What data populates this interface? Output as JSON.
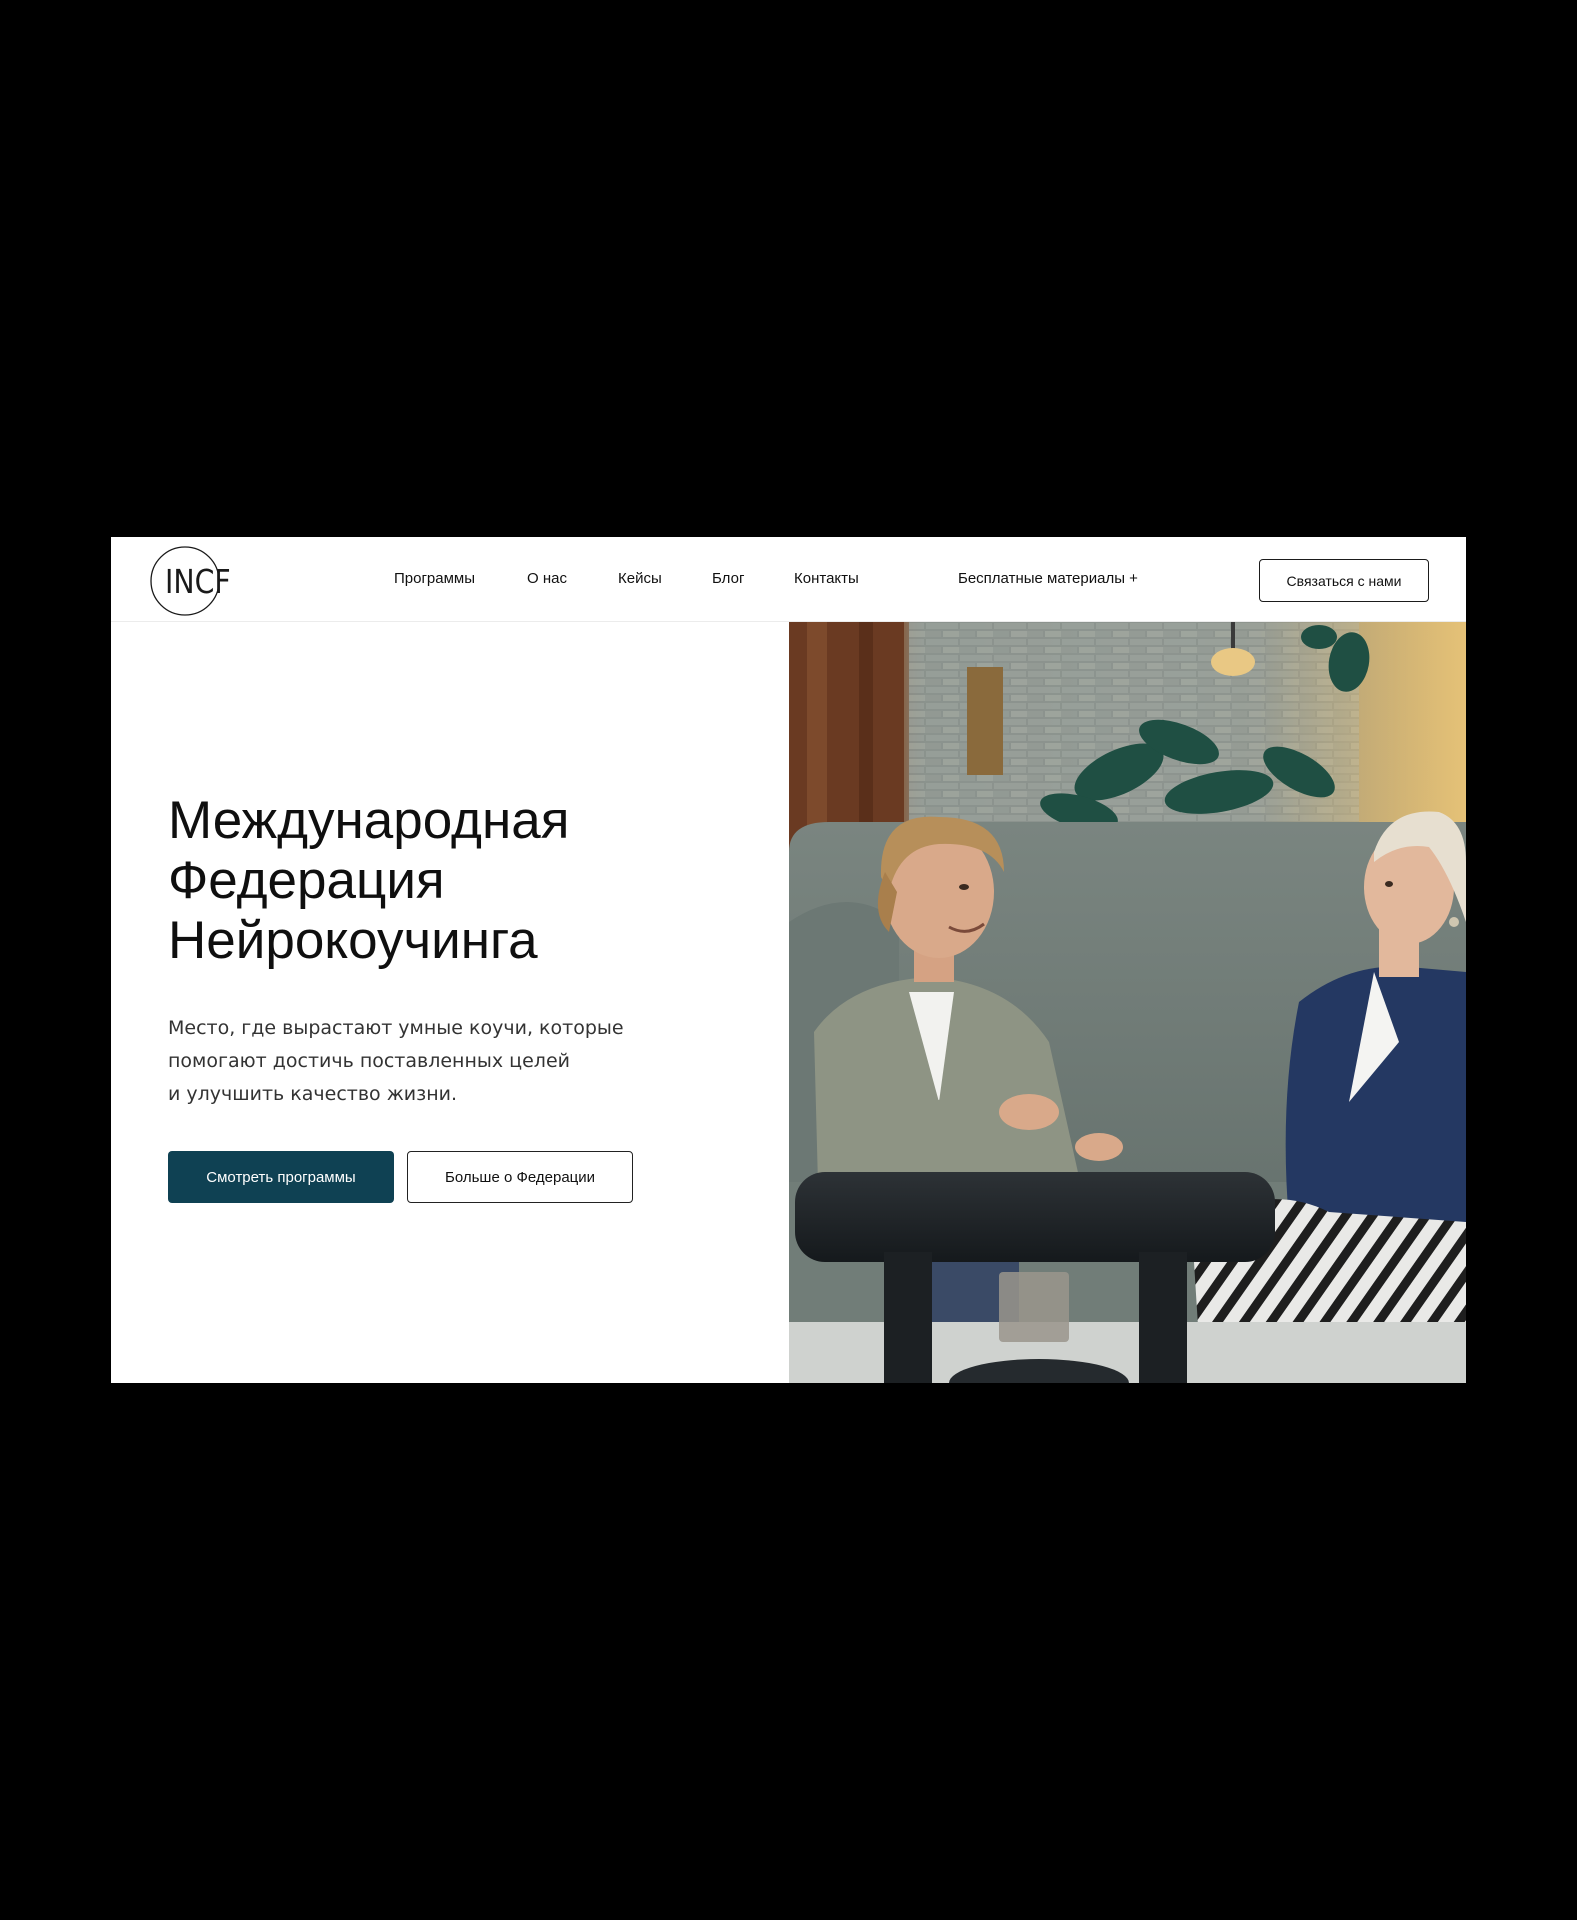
{
  "logo": {
    "text": "INCF"
  },
  "nav": {
    "items": [
      {
        "label": "Программы"
      },
      {
        "label": "О нас"
      },
      {
        "label": "Кейсы"
      },
      {
        "label": "Блог"
      },
      {
        "label": "Контакты"
      }
    ],
    "free_materials": "Бесплатные материалы +",
    "contact_button": "Связаться с нами"
  },
  "hero": {
    "title_lines": [
      "Международная",
      "Федерация",
      "Нейрокоучинга"
    ],
    "subtitle_lines": [
      "Место, где вырастают умные коучи, которые",
      "помогают достичь поставленных целей",
      "и улучшить качество жизни."
    ],
    "primary_button": "Смотреть программы",
    "secondary_button": "Больше о Федерации"
  },
  "colors": {
    "outer_background": "#000000",
    "page_background": "#ffffff",
    "primary_button": "#0f4153",
    "text": "#111111"
  },
  "icons": {
    "logo_ring": "circle-outline-icon"
  }
}
